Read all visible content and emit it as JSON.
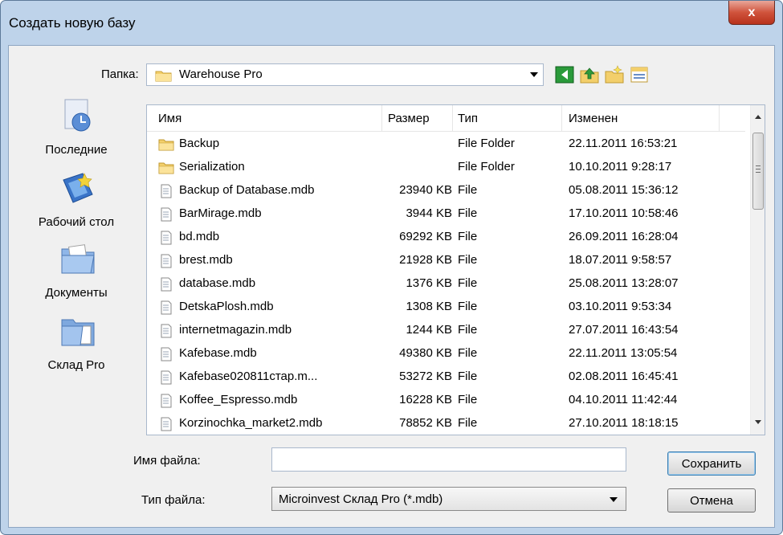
{
  "window": {
    "title": "Создать новую базу",
    "close_glyph": "x"
  },
  "folder": {
    "label": "Папка:",
    "value": "Warehouse Pro"
  },
  "toolbar": {
    "icons": [
      "back-icon",
      "up-folder-icon",
      "new-folder-icon",
      "view-menu-icon"
    ]
  },
  "places": [
    {
      "label": "Последние",
      "icon": "recent-icon"
    },
    {
      "label": "Рабочий стол",
      "icon": "desktop-icon"
    },
    {
      "label": "Документы",
      "icon": "documents-icon"
    },
    {
      "label": "Склад Pro",
      "icon": "sklad-pro-icon"
    }
  ],
  "list": {
    "columns": {
      "name": "Имя",
      "size": "Размер",
      "type": "Тип",
      "modified": "Изменен"
    },
    "rows": [
      {
        "name": "Backup",
        "size": "",
        "type": "File Folder",
        "modified": "22.11.2011 16:53:21",
        "icon": "folder-icon"
      },
      {
        "name": "Serialization",
        "size": "",
        "type": "File Folder",
        "modified": "10.10.2011 9:28:17",
        "icon": "folder-icon"
      },
      {
        "name": "Backup of Database.mdb",
        "size": "23940 KB",
        "type": "File",
        "modified": "05.08.2011 15:36:12",
        "icon": "file-icon"
      },
      {
        "name": "BarMirage.mdb",
        "size": "3944 KB",
        "type": "File",
        "modified": "17.10.2011 10:58:46",
        "icon": "file-icon"
      },
      {
        "name": "bd.mdb",
        "size": "69292 KB",
        "type": "File",
        "modified": "26.09.2011 16:28:04",
        "icon": "file-icon"
      },
      {
        "name": "brest.mdb",
        "size": "21928 KB",
        "type": "File",
        "modified": "18.07.2011 9:58:57",
        "icon": "file-icon"
      },
      {
        "name": "database.mdb",
        "size": "1376 KB",
        "type": "File",
        "modified": "25.08.2011 13:28:07",
        "icon": "file-icon"
      },
      {
        "name": "DetskaPlosh.mdb",
        "size": "1308 KB",
        "type": "File",
        "modified": "03.10.2011 9:53:34",
        "icon": "file-icon"
      },
      {
        "name": "internetmagazin.mdb",
        "size": "1244 KB",
        "type": "File",
        "modified": "27.07.2011 16:43:54",
        "icon": "file-icon"
      },
      {
        "name": "Kafebase.mdb",
        "size": "49380 KB",
        "type": "File",
        "modified": "22.11.2011 13:05:54",
        "icon": "file-icon"
      },
      {
        "name": "Kafebase020811стар.m...",
        "size": "53272 KB",
        "type": "File",
        "modified": "02.08.2011 16:45:41",
        "icon": "file-icon"
      },
      {
        "name": "Koffee_Espresso.mdb",
        "size": "16228 KB",
        "type": "File",
        "modified": "04.10.2011 11:42:44",
        "icon": "file-icon"
      },
      {
        "name": "Korzinochka_market2.mdb",
        "size": "78852 KB",
        "type": "File",
        "modified": "27.10.2011 18:18:15",
        "icon": "file-icon"
      }
    ]
  },
  "filename": {
    "label": "Имя файла:",
    "value": ""
  },
  "filetype": {
    "label": "Тип файла:",
    "value": "Microinvest Склад Pro (*.mdb)"
  },
  "buttons": {
    "save": "Сохранить",
    "cancel": "Отмена"
  }
}
